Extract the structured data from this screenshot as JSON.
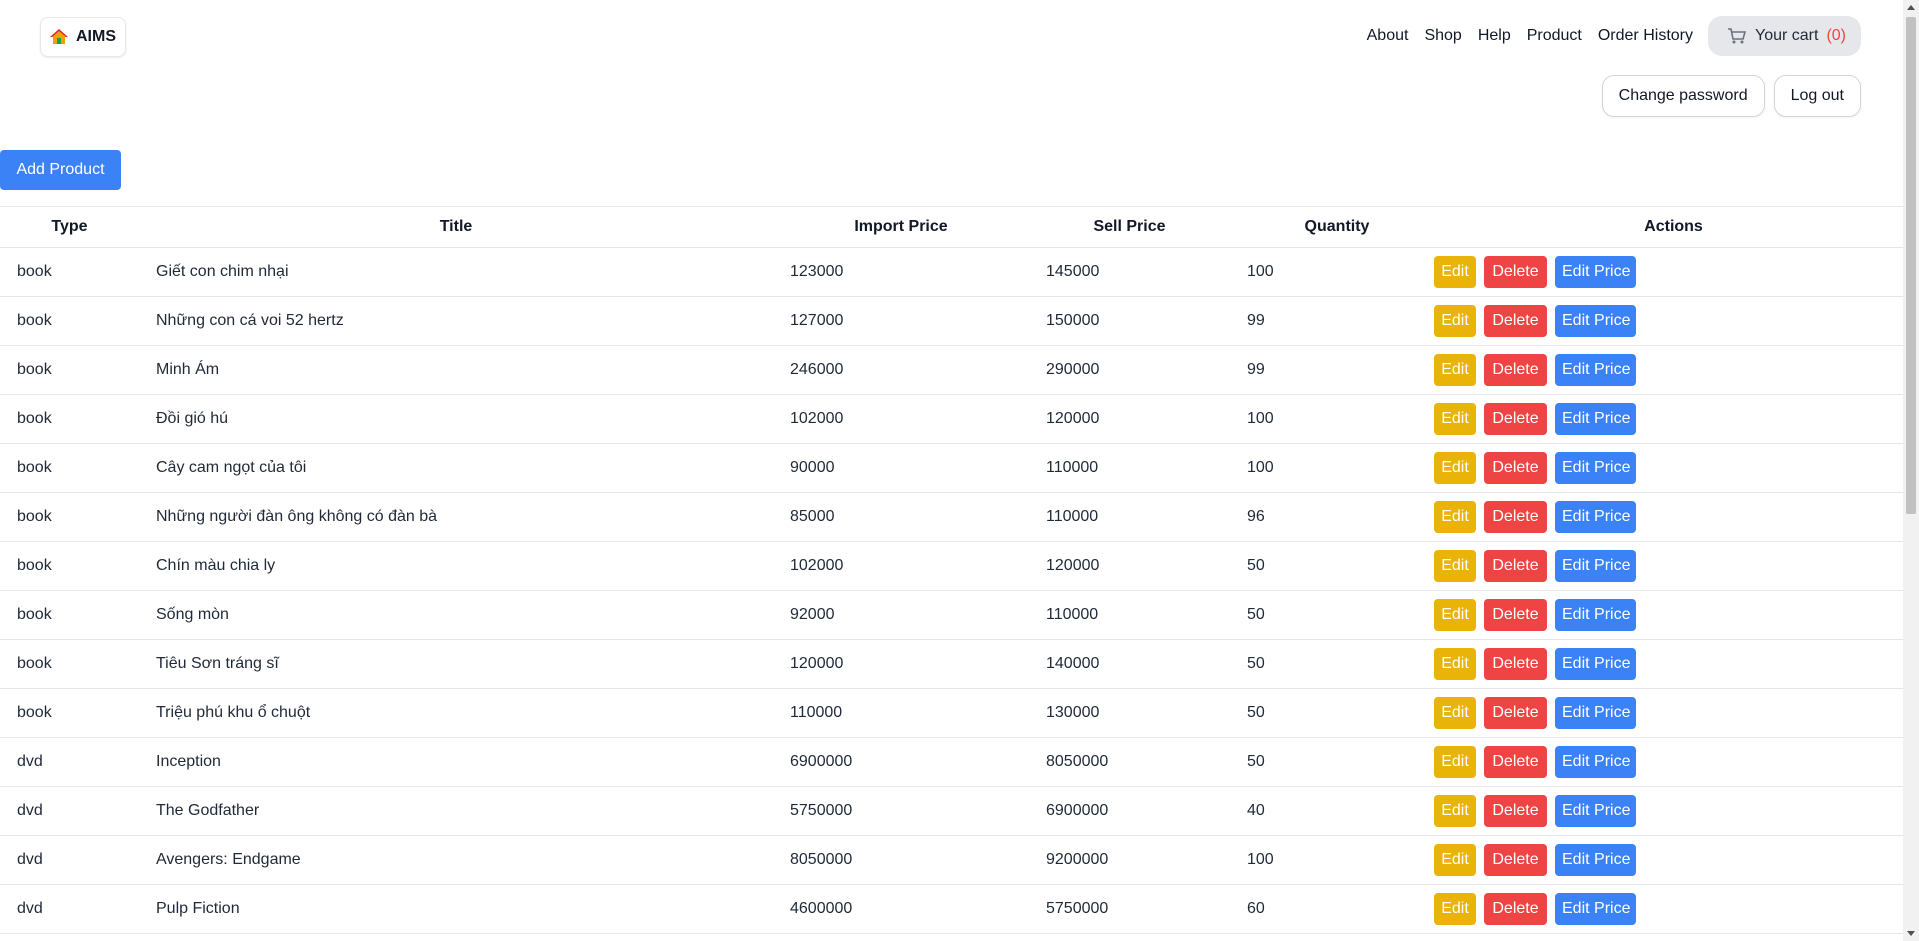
{
  "header": {
    "logo_text": "AIMS",
    "nav": [
      "About",
      "Shop",
      "Help",
      "Product",
      "Order History"
    ],
    "cart_label": "Your cart",
    "cart_count": "(0)",
    "change_password": "Change password",
    "logout": "Log out"
  },
  "main": {
    "add_product": "Add Product"
  },
  "table": {
    "headers": [
      "Type",
      "Title",
      "Import Price",
      "Sell Price",
      "Quantity",
      "Actions"
    ],
    "action_labels": {
      "edit": "Edit",
      "delete": "Delete",
      "edit_price": "Edit Price"
    },
    "rows": [
      {
        "type": "book",
        "title": "Giết con chim nhại",
        "import_price": "123000",
        "sell_price": "145000",
        "quantity": "100"
      },
      {
        "type": "book",
        "title": "Những con cá voi 52 hertz",
        "import_price": "127000",
        "sell_price": "150000",
        "quantity": "99"
      },
      {
        "type": "book",
        "title": "Minh Ám",
        "import_price": "246000",
        "sell_price": "290000",
        "quantity": "99"
      },
      {
        "type": "book",
        "title": "Đồi gió hú",
        "import_price": "102000",
        "sell_price": "120000",
        "quantity": "100"
      },
      {
        "type": "book",
        "title": "Cây cam ngọt của tôi",
        "import_price": "90000",
        "sell_price": "110000",
        "quantity": "100"
      },
      {
        "type": "book",
        "title": "Những người đàn ông không có đàn bà",
        "import_price": "85000",
        "sell_price": "110000",
        "quantity": "96"
      },
      {
        "type": "book",
        "title": "Chín màu chia ly",
        "import_price": "102000",
        "sell_price": "120000",
        "quantity": "50"
      },
      {
        "type": "book",
        "title": "Sống mòn",
        "import_price": "92000",
        "sell_price": "110000",
        "quantity": "50"
      },
      {
        "type": "book",
        "title": "Tiêu Sơn tráng sĩ",
        "import_price": "120000",
        "sell_price": "140000",
        "quantity": "50"
      },
      {
        "type": "book",
        "title": "Triệu phú khu ổ chuột",
        "import_price": "110000",
        "sell_price": "130000",
        "quantity": "50"
      },
      {
        "type": "dvd",
        "title": "Inception",
        "import_price": "6900000",
        "sell_price": "8050000",
        "quantity": "50"
      },
      {
        "type": "dvd",
        "title": "The Godfather",
        "import_price": "5750000",
        "sell_price": "6900000",
        "quantity": "40"
      },
      {
        "type": "dvd",
        "title": "Avengers: Endgame",
        "import_price": "8050000",
        "sell_price": "9200000",
        "quantity": "100"
      },
      {
        "type": "dvd",
        "title": "Pulp Fiction",
        "import_price": "4600000",
        "sell_price": "5750000",
        "quantity": "60"
      }
    ]
  },
  "colors": {
    "primary": "#3b82f6",
    "edit": "#eab308",
    "delete": "#ef4444",
    "cart_bg": "#e5e7eb"
  },
  "icons": {
    "logo": "house-icon",
    "cart": "cart-icon"
  }
}
